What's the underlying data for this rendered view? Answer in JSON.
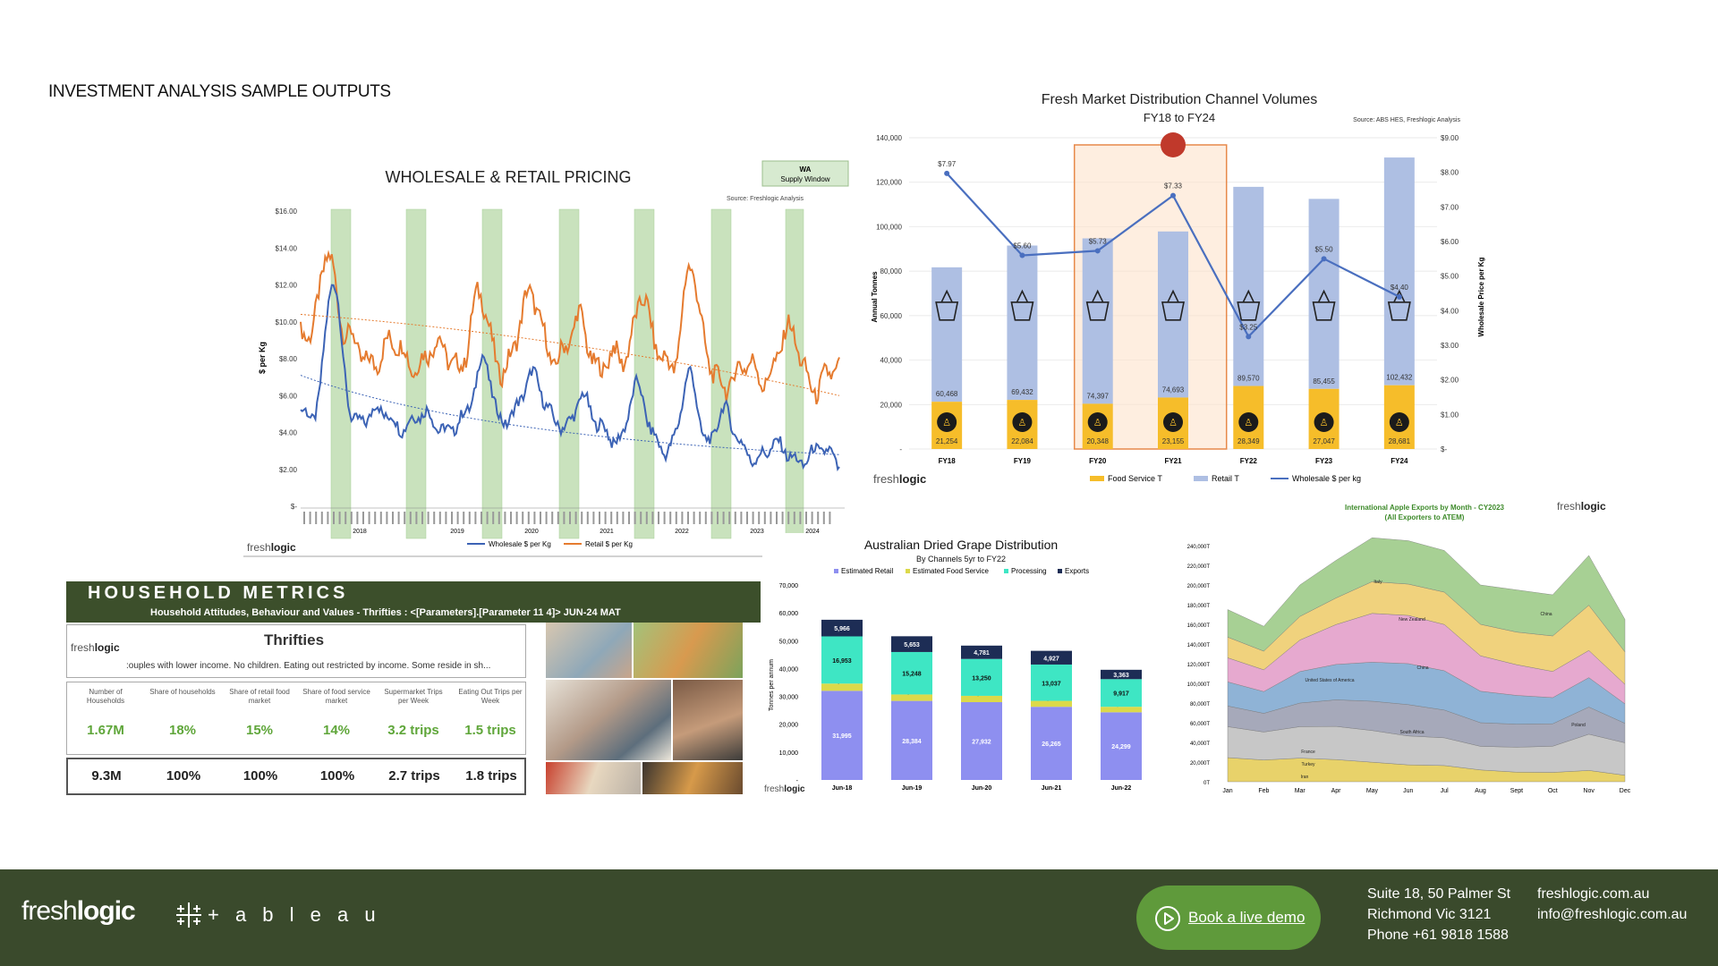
{
  "page": {
    "heading": "INVESTMENT ANALYSIS SAMPLE OUTPUTS"
  },
  "wholesale_chart": {
    "title": "WHOLESALE & RETAIL PRICING",
    "badge": [
      "WA",
      "Supply Window"
    ],
    "source": "Source: Freshlogic Analysis",
    "ylabel": "$ per Kg",
    "yticks": [
      "$16.00",
      "$14.00",
      "$12.00",
      "$10.00",
      "$8.00",
      "$6.00",
      "$4.00",
      "$2.00",
      "$-"
    ],
    "years": [
      "2018",
      "2019",
      "2020",
      "2021",
      "2022",
      "2023",
      "2024"
    ],
    "legend": [
      "Wholesale $ per Kg",
      "Retail $ per Kg"
    ],
    "logo": [
      "fresh",
      "logic"
    ],
    "colors": {
      "wholesale": "#3c63b5",
      "retail": "#e57b2f",
      "window": "#c9e2bd"
    }
  },
  "channel_chart": {
    "title": "Fresh Market Distribution Channel Volumes",
    "subtitle": "FY18 to FY24",
    "source": "Source: ABS HES, Freshlogic Analysis",
    "ylabel_left": "Annual Tonnes",
    "ylabel_right": "Wholesale Price per Kg",
    "left_ticks": [
      "140,000",
      "120,000",
      "100,000",
      "80,000",
      "60,000",
      "40,000",
      "20,000",
      "-"
    ],
    "right_ticks": [
      "$9.00",
      "$8.00",
      "$7.00",
      "$6.00",
      "$5.00",
      "$4.00",
      "$3.00",
      "$2.00",
      "$1.00",
      "$-"
    ],
    "categories": [
      "FY18",
      "FY19",
      "FY20",
      "FY21",
      "FY22",
      "FY23",
      "FY24"
    ],
    "food_service": [
      21254,
      22084,
      20348,
      23155,
      28349,
      27047,
      28681
    ],
    "food_service_labels": [
      "21,254",
      "22,084",
      "20,348",
      "23,155",
      "28,349",
      "27,047",
      "28,681"
    ],
    "retail": [
      60468,
      69432,
      74397,
      74693,
      89570,
      85455,
      102432
    ],
    "retail_labels": [
      "60,468",
      "69,432",
      "74,397",
      "74,693",
      "89,570",
      "85,455",
      "102,432"
    ],
    "price": [
      7.97,
      5.6,
      5.73,
      7.33,
      3.25,
      5.5,
      4.4
    ],
    "price_labels": [
      "$7.97",
      "$5.60",
      "$5.73",
      "$7.33",
      "$3.25",
      "$5.50",
      "$4.40"
    ],
    "legend": [
      "Food Service T",
      "Retail T",
      "Wholesale $ per kg"
    ],
    "logo": [
      "fresh",
      "logic"
    ],
    "colors": {
      "food": "#f6bd2a",
      "retail": "#aebfe3",
      "price": "#4a6fbf",
      "highlight": "#e7894a"
    }
  },
  "household": {
    "band_title": "HOUSEHOLD METRICS",
    "band_subtitle": "Household Attitudes, Behaviour and Values - Thrifties : <[Parameters].[Parameter 11 4]> JUN-24 MAT",
    "logo": [
      "fresh",
      "logic"
    ],
    "segment": "Thrifties",
    "description": ":ouples with lower income. No children. Eating out restricted by income. Some reside in sh...",
    "headers": [
      [
        "Number of",
        "Households"
      ],
      [
        "Share of households"
      ],
      [
        "Share of retail food",
        "market"
      ],
      [
        "Share of food service",
        "market"
      ],
      [
        "Supermarket Trips",
        "per Week"
      ],
      [
        "Eating Out Trips per",
        "Week"
      ]
    ],
    "values": [
      "1.67M",
      "18%",
      "15%",
      "14%",
      "3.2 trips",
      "1.5 trips"
    ],
    "totals": [
      "9.3M",
      "100%",
      "100%",
      "100%",
      "2.7 trips",
      "1.8 trips"
    ]
  },
  "grape_chart": {
    "title": "Australian Dried Grape Distribution",
    "subtitle": "By Channels 5yr to FY22",
    "legend": [
      "Estimated Retail",
      "Estimated Food Service",
      "Processing",
      "Exports"
    ],
    "ylabel": "Tonnes per annum",
    "yticks": [
      "70,000",
      "60,000",
      "50,000",
      "40,000",
      "30,000",
      "20,000",
      "10,000",
      "-"
    ],
    "categories": [
      "Jun-18",
      "Jun-19",
      "Jun-20",
      "Jun-21",
      "Jun-22"
    ],
    "retail": [
      31995,
      28384,
      27932,
      26265,
      24299
    ],
    "retail_labels": [
      "31,995",
      "28,384",
      "27,932",
      "26,265",
      "24,299"
    ],
    "food_service": [
      2594,
      2302,
      2265,
      2130,
      1970
    ],
    "food_service_labels": [
      "2,594",
      "2,302",
      "2,265",
      "2,130",
      "1,970"
    ],
    "processing": [
      16953,
      15248,
      13250,
      13037,
      9917
    ],
    "processing_labels": [
      "16,953",
      "15,248",
      "13,250",
      "13,037",
      "9,917"
    ],
    "exports": [
      5966,
      5653,
      4781,
      4927,
      3363
    ],
    "exports_labels": [
      "5,966",
      "5,653",
      "4,781",
      "4,927",
      "3,363"
    ],
    "logo": [
      "fresh",
      "logic"
    ],
    "colors": {
      "retail": "#8e8ff0",
      "food": "#dcd94a",
      "processing": "#3ee6c4",
      "exports": "#1d2d55"
    }
  },
  "apple_chart": {
    "title": "International Apple Exports by Month - CY2023",
    "subtitle": "(All Exporters to ATEM)",
    "yticks": [
      "240,000T",
      "220,000T",
      "200,000T",
      "180,000T",
      "160,000T",
      "140,000T",
      "120,000T",
      "100,000T",
      "80,000T",
      "60,000T",
      "40,000T",
      "20,000T",
      "0T"
    ],
    "months": [
      "Jan",
      "Feb",
      "Mar",
      "Apr",
      "May",
      "Jun",
      "Jul",
      "Aug",
      "Sept",
      "Oct",
      "Nov",
      "Dec"
    ],
    "region_labels": [
      "Italy",
      "New Zealand",
      "China",
      "China",
      "United States of America",
      "Poland",
      "South Africa",
      "France",
      "Turkey",
      "Iran"
    ],
    "logo": [
      "fresh",
      "logic"
    ]
  },
  "footer": {
    "logo": [
      "fresh",
      "logic"
    ],
    "partner": "+ a b l e a u",
    "demo_label": "Book a live demo",
    "address": [
      "Suite 18, 50 Palmer St",
      "Richmond Vic 3121",
      "Phone +61 9818 1588"
    ],
    "contact": [
      "freshlogic.com.au",
      "info@freshlogic.com.au"
    ],
    "colors": {
      "band": "#3a4a2c",
      "button": "#5f9a3b"
    }
  }
}
